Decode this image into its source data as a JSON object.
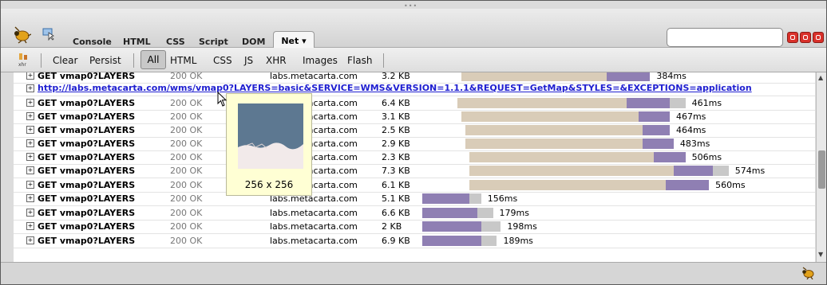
{
  "toolbar": {
    "tabs": [
      "Console",
      "HTML",
      "CSS",
      "Script",
      "DOM"
    ],
    "active_tab": "Net",
    "active_tab_arrow": "▾",
    "search_placeholder": ""
  },
  "net_toolbar": {
    "clear": "Clear",
    "persist": "Persist",
    "filters": [
      "All",
      "HTML",
      "CSS",
      "JS",
      "XHR",
      "Images",
      "Flash"
    ]
  },
  "requests": [
    {
      "url": "GET vmap0?LAYERS",
      "status": "200 OK",
      "domain": "labs.metacarta.com",
      "size": "3.2 KB",
      "time": "384ms",
      "timing": {
        "wait_start": 0.1,
        "wait_len": 0.37,
        "recv_len": 0.11,
        "cache_len": 0.0
      }
    },
    {
      "link": "http://labs.metacarta.com/wms/vmap0?LAYERS=basic&SERVICE=WMS&VERSION=1.1.1&REQUEST=GetMap&STYLES=&EXCEPTIONS=application"
    },
    {
      "url": "GET vmap0?LAYERS",
      "status": "200 OK",
      "domain": "labs.metacarta.com",
      "size": "6.4 KB",
      "time": "461ms",
      "timing": {
        "wait_start": 0.09,
        "wait_len": 0.43,
        "recv_len": 0.11,
        "cache_len": 0.04
      }
    },
    {
      "url": "GET vmap0?LAYERS",
      "status": "200 OK",
      "domain": "labs.metacarta.com",
      "size": "3.1 KB",
      "time": "467ms",
      "timing": {
        "wait_start": 0.1,
        "wait_len": 0.45,
        "recv_len": 0.08,
        "cache_len": 0.0
      }
    },
    {
      "url": "GET vmap0?LAYERS",
      "status": "200 OK",
      "domain": "labs.metacarta.com",
      "size": "2.5 KB",
      "time": "464ms",
      "timing": {
        "wait_start": 0.11,
        "wait_len": 0.45,
        "recv_len": 0.07,
        "cache_len": 0.0
      }
    },
    {
      "url": "GET vmap0?LAYERS",
      "status": "200 OK",
      "domain": "labs.metacarta.com",
      "size": "2.9 KB",
      "time": "483ms",
      "timing": {
        "wait_start": 0.11,
        "wait_len": 0.45,
        "recv_len": 0.08,
        "cache_len": 0.0
      }
    },
    {
      "url": "GET vmap0?LAYERS",
      "status": "200 OK",
      "domain": "labs.metacarta.com",
      "size": "2.3 KB",
      "time": "506ms",
      "timing": {
        "wait_start": 0.12,
        "wait_len": 0.47,
        "recv_len": 0.08,
        "cache_len": 0.0
      }
    },
    {
      "url": "GET vmap0?LAYERS",
      "status": "200 OK",
      "domain": "labs.metacarta.com",
      "size": "7.3 KB",
      "time": "574ms",
      "timing": {
        "wait_start": 0.12,
        "wait_len": 0.52,
        "recv_len": 0.1,
        "cache_len": 0.04
      }
    },
    {
      "url": "GET vmap0?LAYERS",
      "status": "200 OK",
      "domain": "labs.metacarta.com",
      "size": "6.1 KB",
      "time": "560ms",
      "timing": {
        "wait_start": 0.12,
        "wait_len": 0.5,
        "recv_len": 0.11,
        "cache_len": 0.0
      }
    },
    {
      "url": "GET vmap0?LAYERS",
      "status": "200 OK",
      "domain": "labs.metacarta.com",
      "size": "5.1 KB",
      "time": "156ms",
      "timing": {
        "wait_start": 0.0,
        "wait_len": 0.0,
        "recv_len": 0.12,
        "cache_len": 0.03
      }
    },
    {
      "url": "GET vmap0?LAYERS",
      "status": "200 OK",
      "domain": "labs.metacarta.com",
      "size": "6.6 KB",
      "time": "179ms",
      "timing": {
        "wait_start": 0.0,
        "wait_len": 0.0,
        "recv_len": 0.14,
        "cache_len": 0.04
      }
    },
    {
      "url": "GET vmap0?LAYERS",
      "status": "200 OK",
      "domain": "labs.metacarta.com",
      "size": "2 KB",
      "time": "198ms",
      "timing": {
        "wait_start": 0.0,
        "wait_len": 0.0,
        "recv_len": 0.15,
        "cache_len": 0.05
      }
    },
    {
      "url": "GET vmap0?LAYERS",
      "status": "200 OK",
      "domain": "labs.metacarta.com",
      "size": "6.9 KB",
      "time": "189ms",
      "timing": {
        "wait_start": 0.0,
        "wait_len": 0.0,
        "recv_len": 0.15,
        "cache_len": 0.04
      }
    }
  ],
  "tooltip": {
    "dimensions": "256 x 256"
  },
  "colors": {
    "wait_bar": "#d9ccb8",
    "receive_bar": "#8f7fb3",
    "cache_bar": "#c8c8c8",
    "link": "#2020d0",
    "tooltip_bg": "#ffffd4",
    "close_buttons": "#d9302a"
  },
  "icons": [
    "firebug-icon",
    "inspect-icon",
    "xhr-icon",
    "minimize-icon",
    "restore-icon",
    "close-icon",
    "expand-icon",
    "scroll-up-icon",
    "scroll-down-icon",
    "cursor-icon"
  ]
}
